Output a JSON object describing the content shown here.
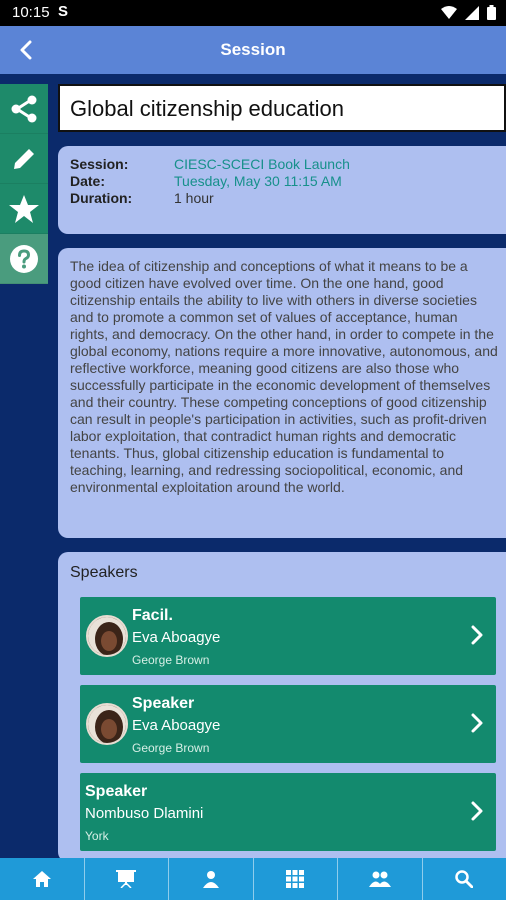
{
  "status_bar": {
    "time": "10:15",
    "s_icon": "S"
  },
  "header": {
    "title": "Session",
    "back_icon": "chevron-left-icon"
  },
  "side_rail": {
    "icons": [
      "share-icon",
      "edit-icon",
      "star-icon",
      "help-icon"
    ]
  },
  "session": {
    "title": "Global citizenship education",
    "session_label": "Session:",
    "session_value": "CIESC-SCECI Book Launch",
    "date_label": "Date:",
    "date_value": "Tuesday, May 30 11:15 AM",
    "duration_label": "Duration:",
    "duration_value": "1 hour",
    "description": "The idea of citizenship and conceptions of what it means to be a good citizen have evolved over time. On the one hand, good citizenship entails the ability to live with others in diverse societies and to promote a common set of values of acceptance, human rights, and democracy. On the other hand, in order to compete in the global economy, nations require a more innovative, autonomous, and reflective workforce, meaning good citizens are also those who successfully participate in the economic development of themselves and their country. These competing conceptions of good citizenship can result in people's participation in activities, such as profit-driven labor exploitation, that contradict human rights and democratic tenants. Thus, global citizenship education is fundamental to teaching, learning, and redressing sociopolitical, economic, and environmental exploitation around the world."
  },
  "speakers": {
    "heading": "Speakers",
    "items": [
      {
        "role": "Facil.",
        "name": "Eva Aboagye",
        "org": "George Brown"
      },
      {
        "role": "Speaker",
        "name": "Eva Aboagye",
        "org": "George Brown"
      },
      {
        "role": "Speaker",
        "name": "Nombuso Dlamini",
        "org": "York"
      }
    ]
  },
  "bottom_nav": {
    "icons": [
      "home-icon",
      "presentation-icon",
      "user-icon",
      "grid-icon",
      "people-icon",
      "search-icon"
    ]
  },
  "colors": {
    "app_bar": "#5b84d6",
    "card": "#aebff0",
    "accent_green": "#138a6e",
    "nav": "#1f9ad8",
    "link_teal": "#17908b"
  }
}
